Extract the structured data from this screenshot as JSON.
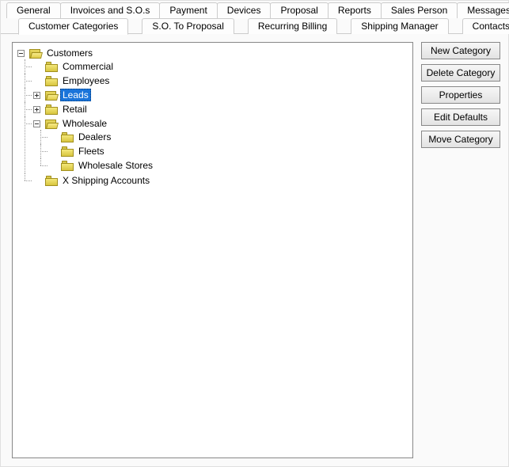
{
  "tabs_row1": {
    "general": "General",
    "invoices": "Invoices and S.O.s",
    "payment": "Payment",
    "devices": "Devices",
    "proposal": "Proposal",
    "reports": "Reports",
    "sales_person": "Sales Person",
    "messages": "Messages"
  },
  "tabs_row2": {
    "customer_categories": "Customer Categories",
    "so_to_proposal": "S.O. To Proposal",
    "recurring_billing": "Recurring Billing",
    "shipping_manager": "Shipping Manager",
    "contacts": "Contacts"
  },
  "tree": {
    "root": "Customers",
    "commercial": "Commercial",
    "employees": "Employees",
    "leads": "Leads",
    "retail": "Retail",
    "wholesale": "Wholesale",
    "dealers": "Dealers",
    "fleets": "Fleets",
    "wholesale_stores": "Wholesale Stores",
    "x_shipping_accounts": "X Shipping Accounts"
  },
  "buttons": {
    "new_category": "New Category",
    "delete_category": "Delete Category",
    "properties": "Properties",
    "edit_defaults": "Edit Defaults",
    "move_category": "Move Category"
  }
}
